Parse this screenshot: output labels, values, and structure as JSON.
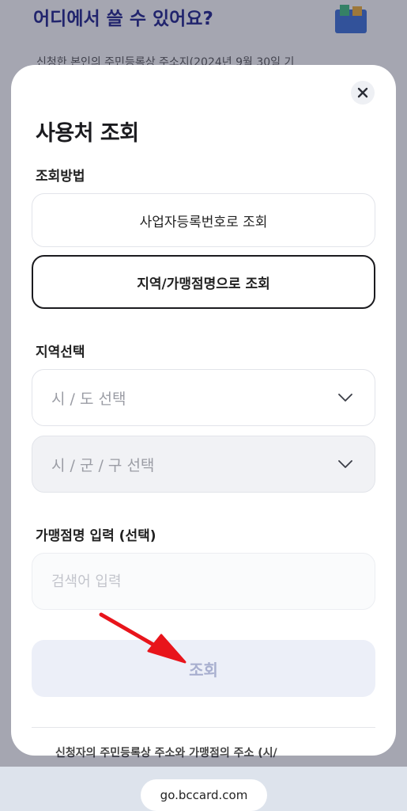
{
  "background": {
    "title": "어디에서 쓸 수 있어요?",
    "description": "신청한 본인의 주민등록상 주소지(2024년 9월 30일 기",
    "bottom_text": "신청자의 주민등록상 주소와 가맹점의 주소 (시/"
  },
  "modal": {
    "title": "사용처 조회",
    "close_icon": "close-icon",
    "method_label": "조회방법",
    "method_options": [
      {
        "label": "사업자등록번호로 조회",
        "selected": false
      },
      {
        "label": "지역/가맹점명으로 조회",
        "selected": true
      }
    ],
    "region_label": "지역선택",
    "province_select": {
      "value": "시 / 도 선택",
      "icon": "chevron-down-icon"
    },
    "district_select": {
      "value": "시 / 군 / 구 선택",
      "icon": "chevron-down-icon",
      "disabled": true
    },
    "store_label": "가맹점명 입력 (선택)",
    "store_input": {
      "placeholder": "검색어 입력",
      "value": ""
    },
    "submit_label": "조회",
    "bottom_text": "신청자의 주민등록상 주소와 가맹점의 주소 (시/"
  },
  "browser": {
    "url": "go.bccard.com"
  },
  "colors": {
    "accent": "#1c1f8a",
    "annotation_arrow": "#e8141b",
    "submit_disabled_bg": "#eceff8",
    "submit_disabled_text": "#a8afcf"
  }
}
